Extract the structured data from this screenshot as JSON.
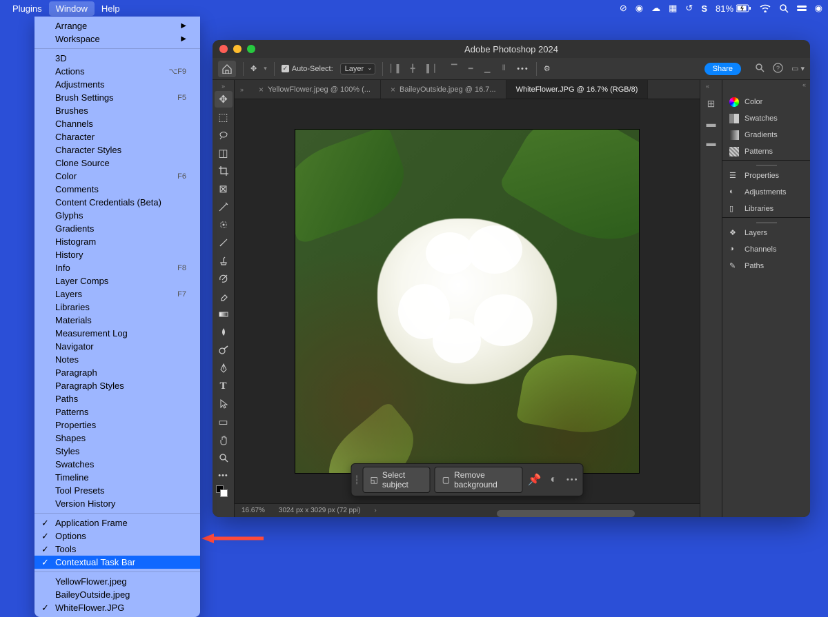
{
  "menubar": {
    "items": [
      "Plugins",
      "Window",
      "Help"
    ],
    "active": "Window",
    "status": {
      "battery": "81%",
      "battery_icon": "charging"
    }
  },
  "dropdown": {
    "groups": [
      [
        {
          "label": "Arrange",
          "submenu": true
        },
        {
          "label": "Workspace",
          "submenu": true
        }
      ],
      [
        {
          "label": "3D"
        },
        {
          "label": "Actions",
          "shortcut": "⌥F9"
        },
        {
          "label": "Adjustments"
        },
        {
          "label": "Brush Settings",
          "shortcut": "F5"
        },
        {
          "label": "Brushes"
        },
        {
          "label": "Channels"
        },
        {
          "label": "Character"
        },
        {
          "label": "Character Styles"
        },
        {
          "label": "Clone Source"
        },
        {
          "label": "Color",
          "shortcut": "F6"
        },
        {
          "label": "Comments"
        },
        {
          "label": "Content Credentials (Beta)"
        },
        {
          "label": "Glyphs"
        },
        {
          "label": "Gradients"
        },
        {
          "label": "Histogram"
        },
        {
          "label": "History"
        },
        {
          "label": "Info",
          "shortcut": "F8"
        },
        {
          "label": "Layer Comps"
        },
        {
          "label": "Layers",
          "shortcut": "F7"
        },
        {
          "label": "Libraries"
        },
        {
          "label": "Materials"
        },
        {
          "label": "Measurement Log"
        },
        {
          "label": "Navigator"
        },
        {
          "label": "Notes"
        },
        {
          "label": "Paragraph"
        },
        {
          "label": "Paragraph Styles"
        },
        {
          "label": "Paths"
        },
        {
          "label": "Patterns"
        },
        {
          "label": "Properties"
        },
        {
          "label": "Shapes"
        },
        {
          "label": "Styles"
        },
        {
          "label": "Swatches"
        },
        {
          "label": "Timeline"
        },
        {
          "label": "Tool Presets"
        },
        {
          "label": "Version History"
        }
      ],
      [
        {
          "label": "Application Frame",
          "checked": true
        },
        {
          "label": "Options",
          "checked": true
        },
        {
          "label": "Tools",
          "checked": true
        },
        {
          "label": "Contextual Task Bar",
          "checked": true,
          "highlighted": true
        }
      ],
      [
        {
          "label": "YellowFlower.jpeg"
        },
        {
          "label": "BaileyOutside.jpeg"
        },
        {
          "label": "WhiteFlower.JPG",
          "checked": true
        }
      ]
    ]
  },
  "photoshop": {
    "title": "Adobe Photoshop 2024",
    "toolbar": {
      "auto_select": "Auto-Select:",
      "layer_select": "Layer",
      "share": "Share"
    },
    "tabs": [
      {
        "label": "YellowFlower.jpeg @ 100% (...",
        "active": false
      },
      {
        "label": "BaileyOutside.jpeg @ 16.7...",
        "active": false
      },
      {
        "label": "WhiteFlower.JPG @ 16.7% (RGB/8)",
        "active": true
      }
    ],
    "context_bar": {
      "select_subject": "Select subject",
      "remove_background": "Remove background"
    },
    "status": {
      "zoom": "16.67%",
      "dimensions": "3024 px x 3029 px (72 ppi)"
    },
    "panels": {
      "group1": [
        "Color",
        "Swatches",
        "Gradients",
        "Patterns"
      ],
      "group2": [
        "Properties",
        "Adjustments",
        "Libraries"
      ],
      "group3": [
        "Layers",
        "Channels",
        "Paths"
      ]
    }
  }
}
